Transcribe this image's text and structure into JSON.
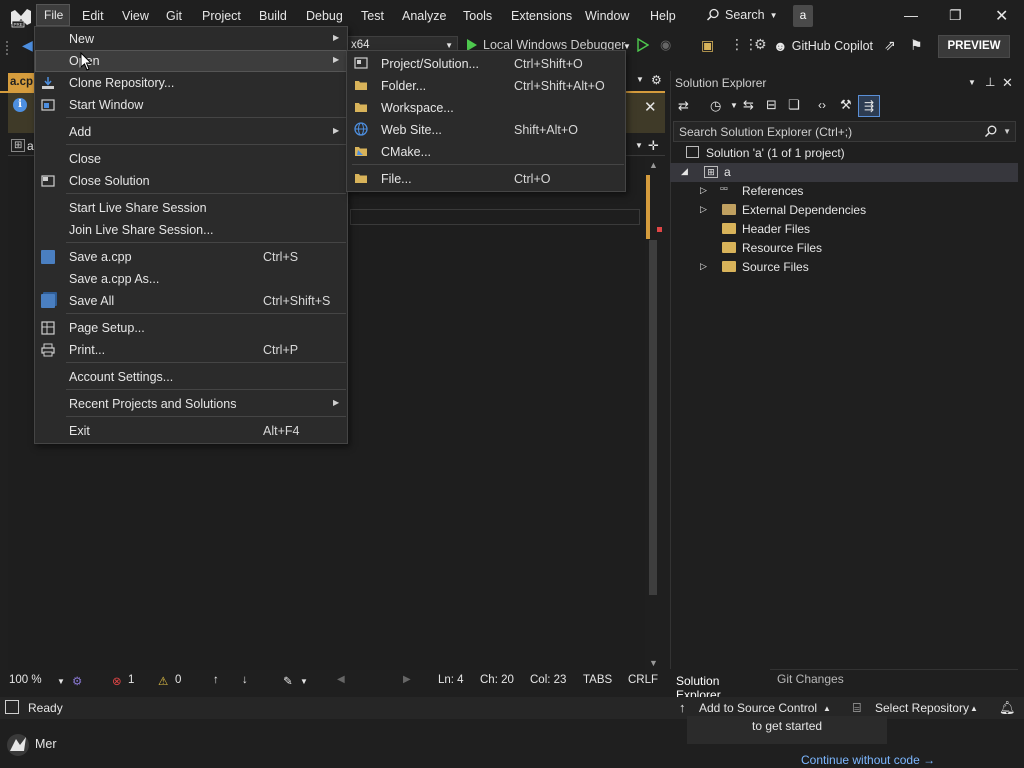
{
  "menubar": {
    "items": [
      "File",
      "Edit",
      "View",
      "Git",
      "Project",
      "Build",
      "Debug",
      "Test",
      "Analyze",
      "Tools",
      "Extensions",
      "Window",
      "Help"
    ],
    "search_label": "Search",
    "avatar_letter": "a"
  },
  "toolbar": {
    "platform": "x64",
    "debugger": "Local Windows Debugger",
    "copilot": "GitHub Copilot",
    "preview": "PREVIEW"
  },
  "editor": {
    "tab_label": "a.cp",
    "nav_fragment": "a",
    "status": {
      "zoom": "100 %",
      "errors": "1",
      "warnings": "0",
      "ln": "Ln: 4",
      "ch": "Ch: 20",
      "col": "Col: 23",
      "tabs": "TABS",
      "eol": "CRLF"
    }
  },
  "file_menu": {
    "items": [
      {
        "label": "New",
        "shortcut": "",
        "submenu": true
      },
      {
        "label": "Open",
        "shortcut": "",
        "submenu": true
      },
      {
        "label": "Clone Repository...",
        "shortcut": ""
      },
      {
        "label": "Start Window",
        "shortcut": ""
      },
      {
        "label": "Add",
        "shortcut": "",
        "submenu": true
      },
      {
        "label": "Close",
        "shortcut": ""
      },
      {
        "label": "Close Solution",
        "shortcut": ""
      },
      {
        "label": "Start Live Share Session",
        "shortcut": ""
      },
      {
        "label": "Join Live Share Session...",
        "shortcut": ""
      },
      {
        "label": "Save a.cpp",
        "shortcut": "Ctrl+S"
      },
      {
        "label": "Save a.cpp As...",
        "shortcut": ""
      },
      {
        "label": "Save All",
        "shortcut": "Ctrl+Shift+S"
      },
      {
        "label": "Page Setup...",
        "shortcut": ""
      },
      {
        "label": "Print...",
        "shortcut": "Ctrl+P"
      },
      {
        "label": "Account Settings...",
        "shortcut": ""
      },
      {
        "label": "Recent Projects and Solutions",
        "shortcut": "",
        "submenu": true
      },
      {
        "label": "Exit",
        "shortcut": "Alt+F4"
      }
    ]
  },
  "open_submenu": {
    "items": [
      {
        "label": "Project/Solution...",
        "shortcut": "Ctrl+Shift+O"
      },
      {
        "label": "Folder...",
        "shortcut": "Ctrl+Shift+Alt+O"
      },
      {
        "label": "Workspace...",
        "shortcut": ""
      },
      {
        "label": "Web Site...",
        "shortcut": "Shift+Alt+O"
      },
      {
        "label": "CMake...",
        "shortcut": ""
      },
      {
        "label": "File...",
        "shortcut": "Ctrl+O"
      }
    ]
  },
  "solution_explorer": {
    "title": "Solution Explorer",
    "search_placeholder": "Search Solution Explorer (Ctrl+;)",
    "solution": "Solution 'a' (1 of 1 project)",
    "project": "a",
    "nodes": [
      "References",
      "External Dependencies",
      "Header Files",
      "Resource Files",
      "Source Files"
    ],
    "tabs": [
      "Solution Explorer",
      "Git Changes"
    ]
  },
  "statusbar": {
    "ready": "Ready",
    "source_control": "Add to Source Control",
    "select_repo": "Select Repository",
    "popup_text": "to get started",
    "continue": "Continue without code →",
    "taskbar_text": "Mer"
  },
  "colors": {
    "accent": "#d59c3d",
    "menu_bg": "#2b2b2b",
    "link": "#7cb7ff",
    "error": "#e04646",
    "info": "#4d8fe0"
  }
}
